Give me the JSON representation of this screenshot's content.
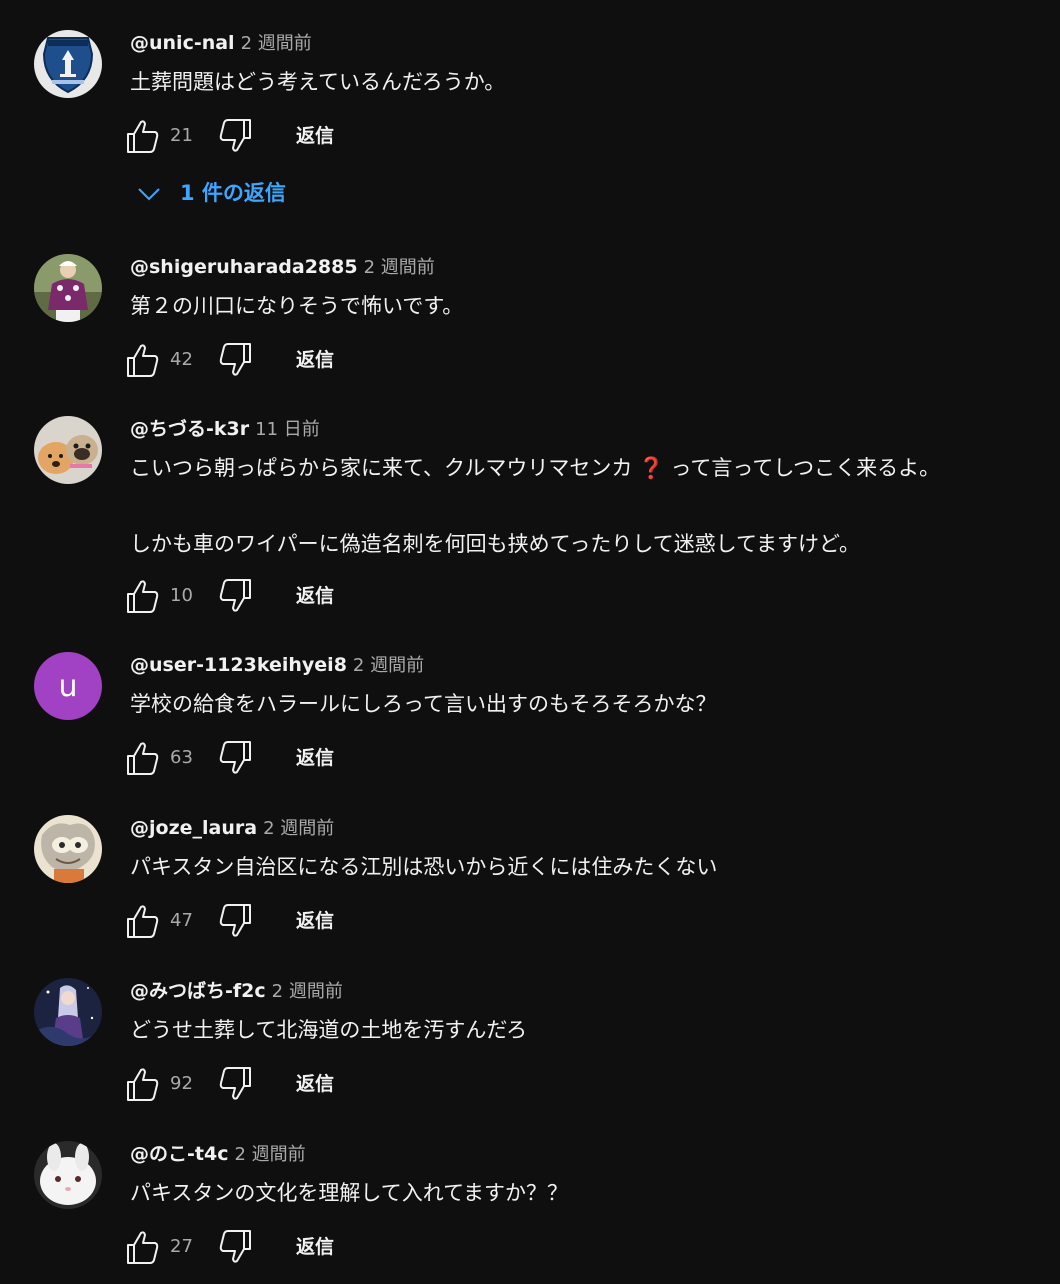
{
  "comments": [
    {
      "handle": "@unic-nal",
      "time": "2 週間前",
      "text": "土葬問題はどう考えているんだろうか。",
      "likes": "21",
      "reply_label": "返信",
      "avatar_icon": "badge-emblem-icon",
      "replies_label": "1 件の返信"
    },
    {
      "handle": "@shigeruharada2885",
      "time": "2 週間前",
      "text": "第２の川口になりそうで怖いです。",
      "likes": "42",
      "reply_label": "返信",
      "avatar_icon": "jockey-photo-icon"
    },
    {
      "handle": "@ちづる-k3r",
      "time": "11 日前",
      "text_line1_before": "こいつら朝っぱらから家に来て、クルマウリマセンカ",
      "text_line1_mark": "❓",
      "text_line1_after": "って言ってしつこく来るよ。",
      "text_line2": "しかも車のワイパーに偽造名刺を何回も挟めてったりして迷惑してますけど。",
      "likes": "10",
      "reply_label": "返信",
      "avatar_icon": "dogs-photo-icon"
    },
    {
      "handle": "@user-1123keihyei8",
      "time": "2 週間前",
      "text": "学校の給食をハラールにしろって言い出すのもそろそろかな？",
      "likes": "63",
      "reply_label": "返信",
      "avatar_letter": "u",
      "avatar_color": "#a142c4"
    },
    {
      "handle": "@joze_laura",
      "time": "2 週間前",
      "text": "パキスタン自治区になる江別は恐いから近くには住みたくない",
      "likes": "47",
      "reply_label": "返信",
      "avatar_icon": "illustration-photo-icon"
    },
    {
      "handle": "@みつばち-f2c",
      "time": "2 週間前",
      "text": "どうせ土葬して北海道の土地を汚すんだろ",
      "likes": "92",
      "reply_label": "返信",
      "avatar_icon": "anime-character-icon"
    },
    {
      "handle": "@のこ-t4c",
      "time": "2 週間前",
      "text": "パキスタンの文化を理解して入れてますか？？",
      "likes": "27",
      "reply_label": "返信",
      "avatar_icon": "white-rabbit-icon"
    }
  ],
  "colors": {
    "background": "#0f0f0f",
    "text": "#f1f1f1",
    "secondary": "#aaaaaa",
    "link": "#3ea6ff"
  }
}
